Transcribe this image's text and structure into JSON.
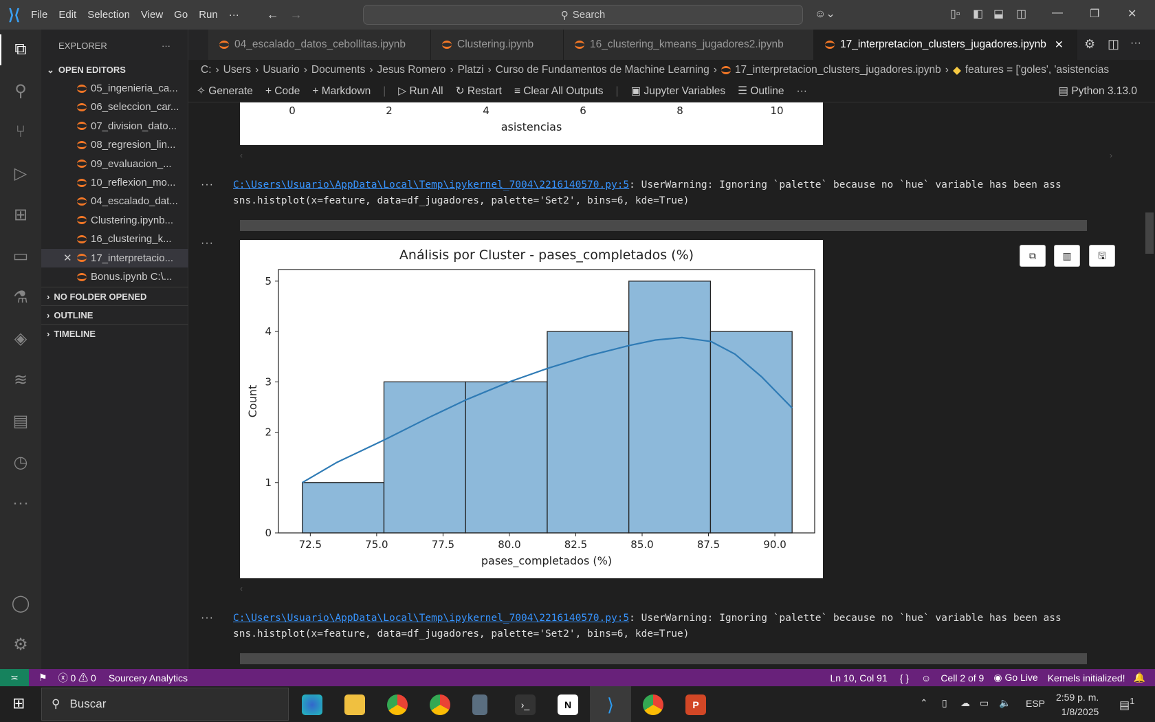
{
  "titlebar": {
    "menus": [
      "File",
      "Edit",
      "Selection",
      "View",
      "Go",
      "Run",
      "···"
    ],
    "search": "Search"
  },
  "sidebar": {
    "title": "EXPLORER",
    "more": "···",
    "open_editors": "OPEN EDITORS",
    "files": [
      "05_ingenieria_ca...",
      "06_seleccion_car...",
      "07_division_dato...",
      "08_regresion_lin...",
      "09_evaluacion_...",
      "10_reflexion_mo...",
      "04_escalado_dat...",
      "Clustering.ipynb...",
      "16_clustering_k...",
      "17_interpretacio...",
      "Bonus.ipynb  C:\\..."
    ],
    "sections": [
      "NO FOLDER OPENED",
      "OUTLINE",
      "TIMELINE"
    ]
  },
  "tabs": [
    "04_escalado_datos_cebollitas.ipynb",
    "Clustering.ipynb",
    "16_clustering_kmeans_jugadores2.ipynb",
    "17_interpretacion_clusters_jugadores.ipynb"
  ],
  "breadcrumb": [
    "C:",
    "Users",
    "Usuario",
    "Documents",
    "Jesus Romero",
    "Platzi",
    "Curso de Fundamentos de Machine Learning",
    "17_interpretacion_clusters_jugadores.ipynb",
    "features = ['goles', 'asistencias"
  ],
  "toolbar": {
    "generate": "Generate",
    "code": "Code",
    "markdown": "Markdown",
    "run_all": "Run All",
    "restart": "Restart",
    "clear": "Clear All Outputs",
    "variables": "Jupyter Variables",
    "outline": "Outline",
    "more": "···",
    "kernel": "Python 3.13.0"
  },
  "prev_chart": {
    "xticks": [
      "0",
      "2",
      "4",
      "6",
      "8",
      "10"
    ],
    "xlabel": "asistencias"
  },
  "output": {
    "dots": "···",
    "link": "C:\\Users\\Usuario\\AppData\\Local\\Temp\\ipykernel_7004\\2216140570.py:5",
    "warning": ": UserWarning: Ignoring `palette` because no `hue` variable has been ass",
    "code": "  sns.histplot(x=feature, data=df_jugadores, palette='Set2', bins=6, kde=True)"
  },
  "chart_data": {
    "type": "bar",
    "title": "Análisis por Cluster - pases_completados (%)",
    "xlabel": "pases_completados (%)",
    "ylabel": "Count",
    "bin_edges": [
      72.2,
      75.275,
      78.35,
      81.425,
      84.5,
      87.575,
      90.65
    ],
    "values": [
      1,
      3,
      3,
      4,
      5,
      4
    ],
    "xticks": [
      72.5,
      75.0,
      77.5,
      80.0,
      82.5,
      85.0,
      87.5,
      90.0
    ],
    "yticks": [
      0,
      1,
      2,
      3,
      4,
      5
    ],
    "xlim": [
      71.3,
      91.5
    ],
    "ylim": [
      0,
      5.23
    ],
    "kde": {
      "x": [
        72.2,
        73.5,
        75.3,
        77,
        78.4,
        80,
        81.45,
        83,
        84.5,
        85.5,
        86.5,
        87.6,
        88.5,
        89.5,
        90.65
      ],
      "y": [
        1,
        1.4,
        1.85,
        2.3,
        2.65,
        3.0,
        3.27,
        3.52,
        3.72,
        3.83,
        3.88,
        3.8,
        3.55,
        3.1,
        2.48
      ]
    },
    "bar_color": "#8db9da",
    "line_color": "#2f7bb5",
    "grid": false
  },
  "status": {
    "errors": "0",
    "warnings": "0",
    "sourcery": "Sourcery Analytics",
    "position": "Ln 10, Col 91",
    "braces": "{ }",
    "cell": "Cell 2 of 9",
    "golive": "Go Live",
    "kernels": "Kernels initialized!"
  },
  "taskbar": {
    "search": "Buscar",
    "lang": "ESP",
    "time": "2:59 p. m.",
    "date": "1/8/2025",
    "notif": "1"
  }
}
